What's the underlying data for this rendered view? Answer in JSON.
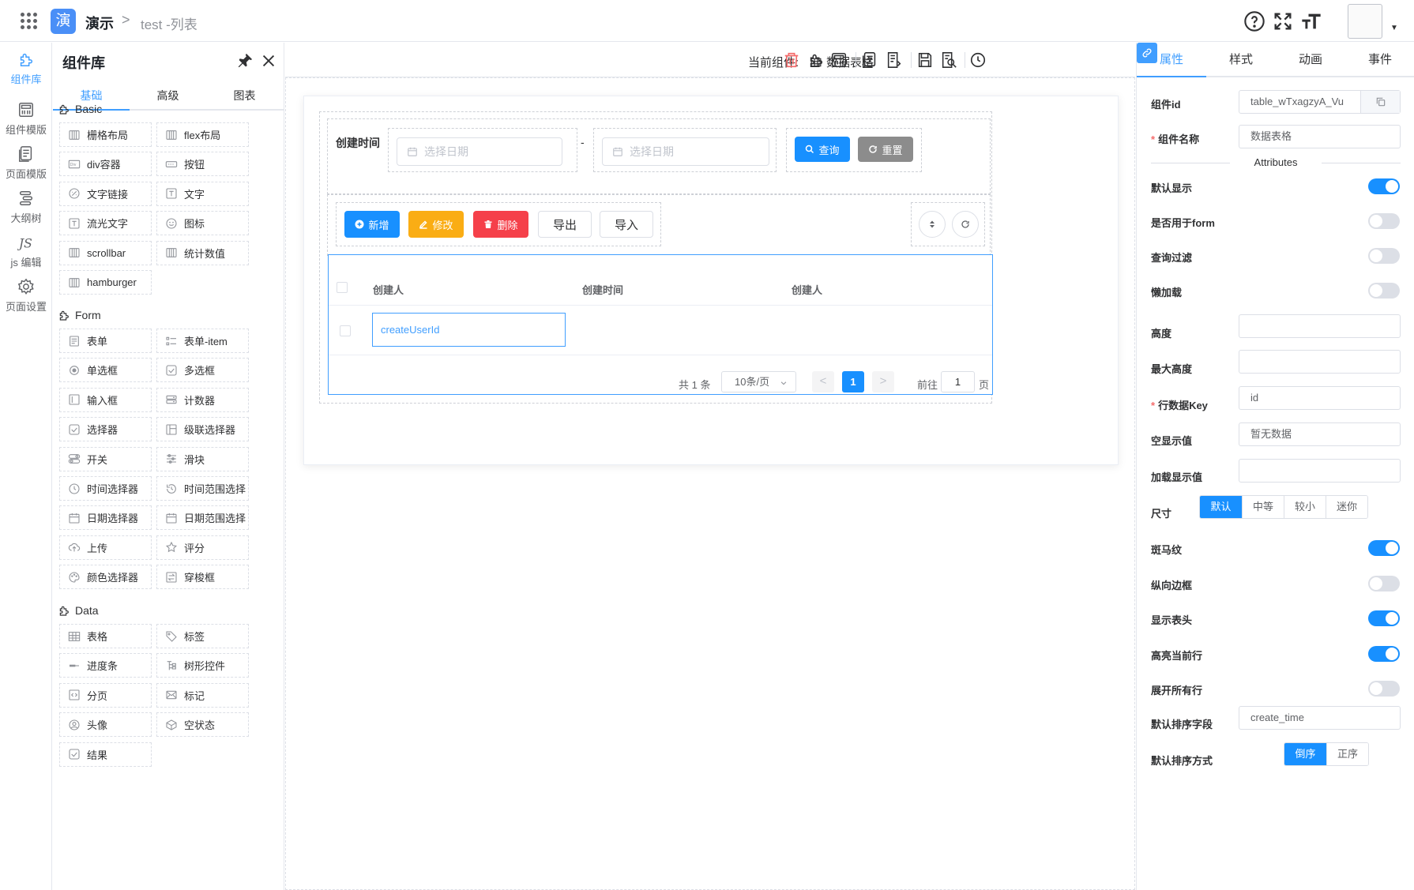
{
  "topbar": {
    "logo_char": "演",
    "app_name": "演示",
    "crumb_sep": ">",
    "crumb": "test -列表"
  },
  "rail": [
    {
      "label": "组件库",
      "icon": "puzzle-icon",
      "active": true
    },
    {
      "label": "组件模版",
      "icon": "template-icon"
    },
    {
      "label": "页面模版",
      "icon": "page-template-icon"
    },
    {
      "label": "大纲树",
      "icon": "outline-tree-icon"
    },
    {
      "label": "js 编辑",
      "icon": "js-icon"
    },
    {
      "label": "页面设置",
      "icon": "gear-icon"
    }
  ],
  "library": {
    "title": "组件库",
    "tabs": [
      "基础",
      "高级",
      "图表"
    ],
    "sections": [
      {
        "title": "Basic",
        "items": [
          "栅格布局",
          "flex布局",
          "div容器",
          "按钮",
          "文字链接",
          "文字",
          "流光文字",
          "图标",
          "scrollbar",
          "统计数值",
          "hamburger"
        ]
      },
      {
        "title": "Form",
        "items": [
          "表单",
          "表单-item",
          "单选框",
          "多选框",
          "输入框",
          "计数器",
          "选择器",
          "级联选择器",
          "开关",
          "滑块",
          "时间选择器",
          "时间范围选择",
          "日期选择器",
          "日期范围选择",
          "上传",
          "评分",
          "颜色选择器",
          "穿梭框"
        ]
      },
      {
        "title": "Data",
        "items": [
          "表格",
          "标签",
          "进度条",
          "树形控件",
          "分页",
          "标记",
          "头像",
          "空状态",
          "结果"
        ]
      }
    ]
  },
  "toolbar": {
    "current_label": "当前组件:",
    "current_value": "数据表格"
  },
  "canvas": {
    "query_label": "创建时间",
    "date_placeholder": "选择日期",
    "range_sep": "-",
    "search_btn": "查询",
    "reset_btn": "重置",
    "add_btn": "新增",
    "edit_btn": "修改",
    "delete_btn": "删除",
    "export_btn": "导出",
    "import_btn": "导入",
    "columns": [
      "创建人",
      "创建时间",
      "创建人"
    ],
    "cell_value": "createUserId",
    "pagination": {
      "total": "共 1 条",
      "page_size": "10条/页",
      "prev": "<",
      "current": "1",
      "next": ">",
      "goto": "前往",
      "goto_value": "1",
      "page_unit": "页"
    }
  },
  "props": {
    "tabs": [
      "属性",
      "样式",
      "动画",
      "事件"
    ],
    "component_id_label": "组件id",
    "component_id": "table_wTxagzyA_Vu",
    "component_name_label": "组件名称",
    "component_name": "数据表格",
    "attributes_title": "Attributes",
    "switches": [
      {
        "label": "默认显示",
        "on": true
      },
      {
        "label": "是否用于form",
        "on": false
      },
      {
        "label": "查询过滤",
        "on": false
      },
      {
        "label": "懒加载",
        "on": false
      }
    ],
    "height_label": "高度",
    "max_height_label": "最大高度",
    "row_key_label": "行数据Key",
    "row_key": "id",
    "empty_label": "空显示值",
    "empty_value": "暂无数据",
    "loading_label": "加载显示值",
    "size_label": "尺寸",
    "size_options": [
      "默认",
      "中等",
      "较小",
      "迷你"
    ],
    "size_selected": "默认",
    "switches2": [
      {
        "label": "斑马纹",
        "on": true
      },
      {
        "label": "纵向边框",
        "on": false
      },
      {
        "label": "显示表头",
        "on": true
      },
      {
        "label": "高亮当前行",
        "on": true
      },
      {
        "label": "展开所有行",
        "on": false
      }
    ],
    "sort_field_label": "默认排序字段",
    "sort_field": "create_time",
    "sort_order_label": "默认排序方式",
    "sort_options": [
      "倒序",
      "正序"
    ],
    "sort_selected": "倒序"
  },
  "colors": {
    "primary": "#1890ff",
    "warning": "#faad14",
    "danger": "#f5404a",
    "gray": "#8c8c8c"
  }
}
